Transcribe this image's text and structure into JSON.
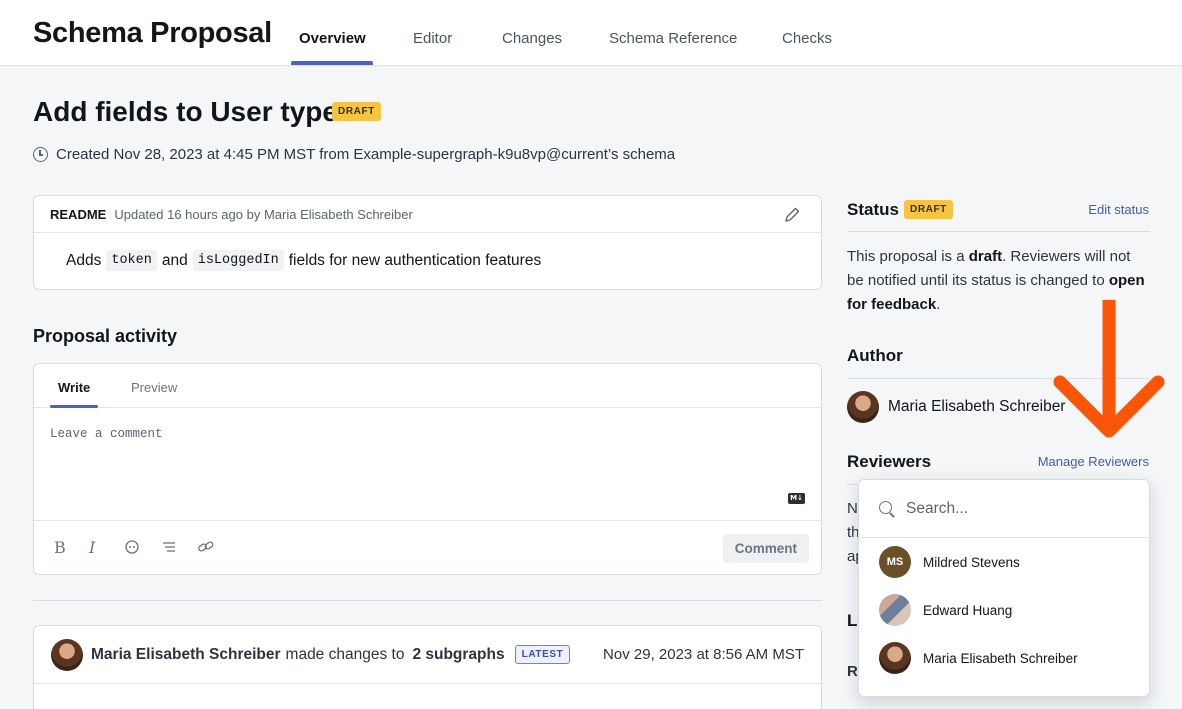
{
  "app": {
    "title": "Schema Proposal"
  },
  "tabs": [
    {
      "label": "Overview"
    },
    {
      "label": "Editor"
    },
    {
      "label": "Changes"
    },
    {
      "label": "Schema Reference"
    },
    {
      "label": "Checks"
    }
  ],
  "proposal": {
    "title": "Add fields to User type",
    "badge": "DRAFT",
    "created": "Created Nov 28, 2023 at 4:45 PM MST from Example-supergraph-k9u8vp@current’s schema"
  },
  "readme": {
    "label": "README",
    "updated": "Updated 16 hours ago by Maria Elisabeth Schreiber",
    "body_prefix": "Adds",
    "code1": "token",
    "and": "and",
    "code2": "isLoggedIn",
    "body_suffix": "fields for new authentication features"
  },
  "activity": {
    "title": "Proposal activity",
    "tab_write": "Write",
    "tab_preview": "Preview",
    "placeholder": "Leave a comment",
    "markdown_badge": "M↓",
    "comment_button": "Comment",
    "entry": {
      "name": "Maria Elisabeth Schreiber",
      "verb": "made changes to",
      "subject": "2 subgraphs",
      "badge": "LATEST",
      "date": "Nov 29, 2023 at 8:56 AM MST"
    }
  },
  "sidebar": {
    "status_title": "Status",
    "status_badge": "DRAFT",
    "edit_status": "Edit status",
    "desc_1": "This proposal is a ",
    "desc_bold_1": "draft",
    "desc_2": ". Reviewers will not be notified until its status is changed to ",
    "desc_bold_2": "open for feedback",
    "desc_3": ".",
    "author_title": "Author",
    "author_name": "Maria Elisabeth Schreiber",
    "reviewers_title": "Reviewers",
    "manage_reviewers": "Manage Reviewers",
    "peek_1": "N",
    "peek_2": "th",
    "peek_3": "ap",
    "peek_4": "La",
    "peek_5": "Re"
  },
  "dropdown": {
    "search_placeholder": "Search...",
    "reviewers": [
      {
        "initials": "MS",
        "name": "Mildred Stevens"
      },
      {
        "name": "Edward Huang"
      },
      {
        "name": "Maria Elisabeth Schreiber"
      }
    ]
  },
  "colors": {
    "accent": "#4b5fc9",
    "draft": "#f6c343",
    "arrow": "#fb5607",
    "link": "#3f5bb8"
  },
  "icons": [
    "clock-icon",
    "pencil-icon",
    "markdown-icon",
    "bold-icon",
    "italic-icon",
    "comment-icon",
    "list-icon",
    "link-icon",
    "search-icon",
    "arrow-down-icon"
  ]
}
